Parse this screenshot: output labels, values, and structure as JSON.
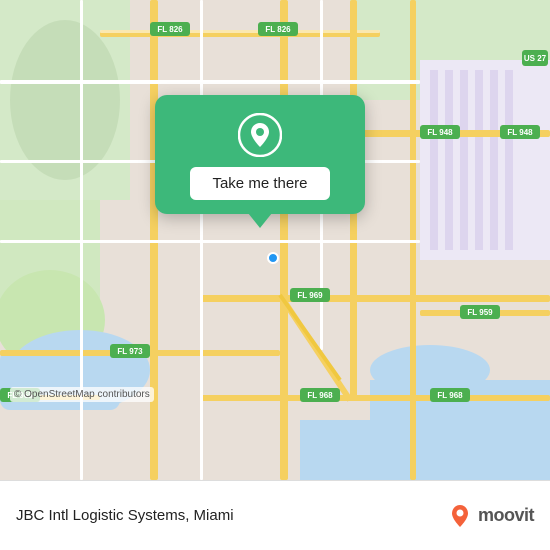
{
  "map": {
    "attribution": "© OpenStreetMap contributors",
    "background_color": "#e8e0d8"
  },
  "popup": {
    "button_label": "Take me there",
    "pin_color": "#ffffff",
    "background_color": "#3db87a"
  },
  "bottom_bar": {
    "destination": "JBC Intl Logistic Systems, Miami",
    "logo_text": "moovit"
  },
  "colors": {
    "road_yellow": "#f5d87a",
    "road_white": "#ffffff",
    "water": "#b3d9f5",
    "green_area": "#c8e6c9",
    "land": "#e8e0d8",
    "airport": "#f0e8f8",
    "popup_green": "#3db87a"
  }
}
